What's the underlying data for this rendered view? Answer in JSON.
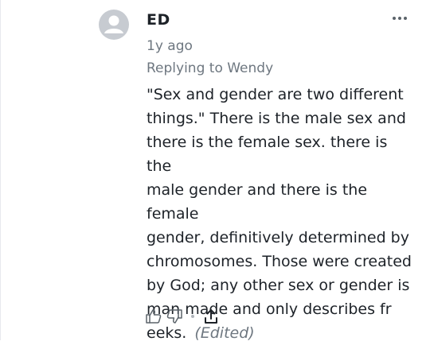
{
  "comment": {
    "author": "ED",
    "time": "1y ago",
    "replying_to": "Replying to Wendy",
    "lines": [
      "\"Sex and gender are two different",
      "things.\" There is the male sex and",
      "there is the female sex. there is the",
      "male gender and there is the female",
      "gender, definitively determined by",
      "chromosomes. Those were created",
      "by God; any other sex or gender is",
      "man made and only describes fr",
      "eeks."
    ],
    "edited_label": "(Edited)"
  },
  "icons": {
    "avatar": "default-user-avatar",
    "more": "more-horizontal",
    "like": "thumbs-up",
    "dislike": "thumbs-down",
    "share": "share-upload"
  },
  "colors": {
    "text": "#1d2228",
    "muted": "#6e7780",
    "avatar": "#c7cbd1",
    "icon": "#5b636a"
  }
}
